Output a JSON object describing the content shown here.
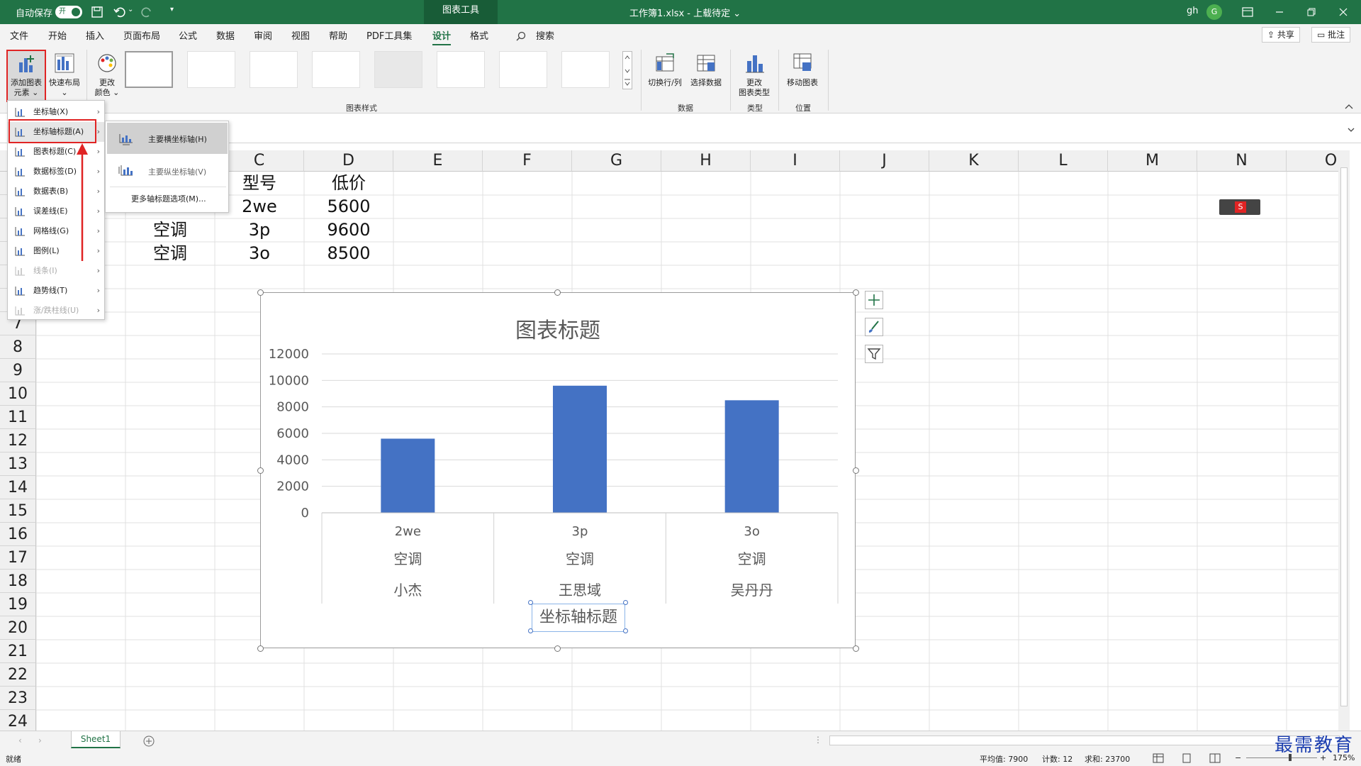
{
  "titlebar": {
    "autosave_label": "自动保存",
    "autosave_state": "开",
    "context_tab": "图表工具",
    "file_title": "工作簿1.xlsx - 上载待定 ⌄",
    "user": "gh",
    "avatar_letter": "G"
  },
  "menu": {
    "items": [
      "文件",
      "开始",
      "插入",
      "页面布局",
      "公式",
      "数据",
      "审阅",
      "视图",
      "帮助",
      "PDF工具集",
      "设计",
      "格式"
    ],
    "search": "搜索",
    "share": "共享",
    "comments": "批注"
  },
  "ribbon": {
    "add_element": "添加图表元素",
    "add_element_l1": "添加图表",
    "add_element_l2": "元素 ⌄",
    "quick_layout": "快速布局",
    "change_color_l1": "更改",
    "change_color_l2": "颜色 ⌄",
    "switch_rowcol": "切换行/列",
    "select_data": "选择数据",
    "change_type_l1": "更改",
    "change_type_l2": "图表类型",
    "move_chart": "移动图表",
    "group_styles": "图表样式",
    "group_data": "数据",
    "group_type": "类型",
    "group_location": "位置"
  },
  "dropdown": {
    "items": [
      {
        "label": "坐标轴(X)",
        "disabled": false
      },
      {
        "label": "坐标轴标题(A)",
        "disabled": false
      },
      {
        "label": "图表标题(C)",
        "disabled": false
      },
      {
        "label": "数据标签(D)",
        "disabled": false
      },
      {
        "label": "数据表(B)",
        "disabled": false
      },
      {
        "label": "误差线(E)",
        "disabled": false
      },
      {
        "label": "网格线(G)",
        "disabled": false
      },
      {
        "label": "图例(L)",
        "disabled": false
      },
      {
        "label": "线条(I)",
        "disabled": true
      },
      {
        "label": "趋势线(T)",
        "disabled": false
      },
      {
        "label": "涨/跌柱线(U)",
        "disabled": true
      }
    ],
    "sub": {
      "primary_h": "主要横坐标轴(H)",
      "primary_v": "主要纵坐标轴(V)",
      "more": "更多轴标题选项(M)..."
    }
  },
  "grid": {
    "columns": [
      "C",
      "D",
      "E",
      "F",
      "G",
      "H",
      "I",
      "J",
      "K",
      "L",
      "M",
      "N",
      "O"
    ],
    "rows": [
      "7",
      "8",
      "9",
      "10",
      "11",
      "12",
      "13",
      "14",
      "15",
      "16",
      "17",
      "18",
      "19",
      "20",
      "21",
      "22",
      "23",
      "24"
    ],
    "header_model": "型号",
    "header_price": "低价",
    "cells": [
      {
        "col_a": "",
        "col_b": "",
        "model": "2we",
        "price": "5600"
      },
      {
        "col_a": "",
        "col_b": "空调",
        "model": "3p",
        "price": "9600"
      },
      {
        "col_a": "",
        "col_b": "空调",
        "model": "3o",
        "price": "8500"
      }
    ]
  },
  "chart_data": {
    "type": "bar",
    "title": "图表标题",
    "categories": [
      "2we",
      "3p",
      "3o"
    ],
    "category_level2": [
      "空调",
      "空调",
      "空调"
    ],
    "category_level3": [
      "小杰",
      "王思域",
      "吴丹丹"
    ],
    "values": [
      5600,
      9600,
      8500
    ],
    "ylim": [
      0,
      12000
    ],
    "yticks": [
      "0",
      "2000",
      "4000",
      "6000",
      "8000",
      "10000",
      "12000"
    ],
    "xlabel": "坐标轴标题",
    "ylabel": "",
    "grid": true,
    "bar_color": "#4472C4"
  },
  "sheet": {
    "tab": "Sheet1"
  },
  "status": {
    "ready": "就绪",
    "average": "平均值: 7900",
    "count": "计数: 12",
    "sum": "求和: 23700",
    "zoom": "175%"
  },
  "watermark": "最需教育",
  "colors": {
    "excel_green": "#217346",
    "highlight_red": "#e02424"
  }
}
